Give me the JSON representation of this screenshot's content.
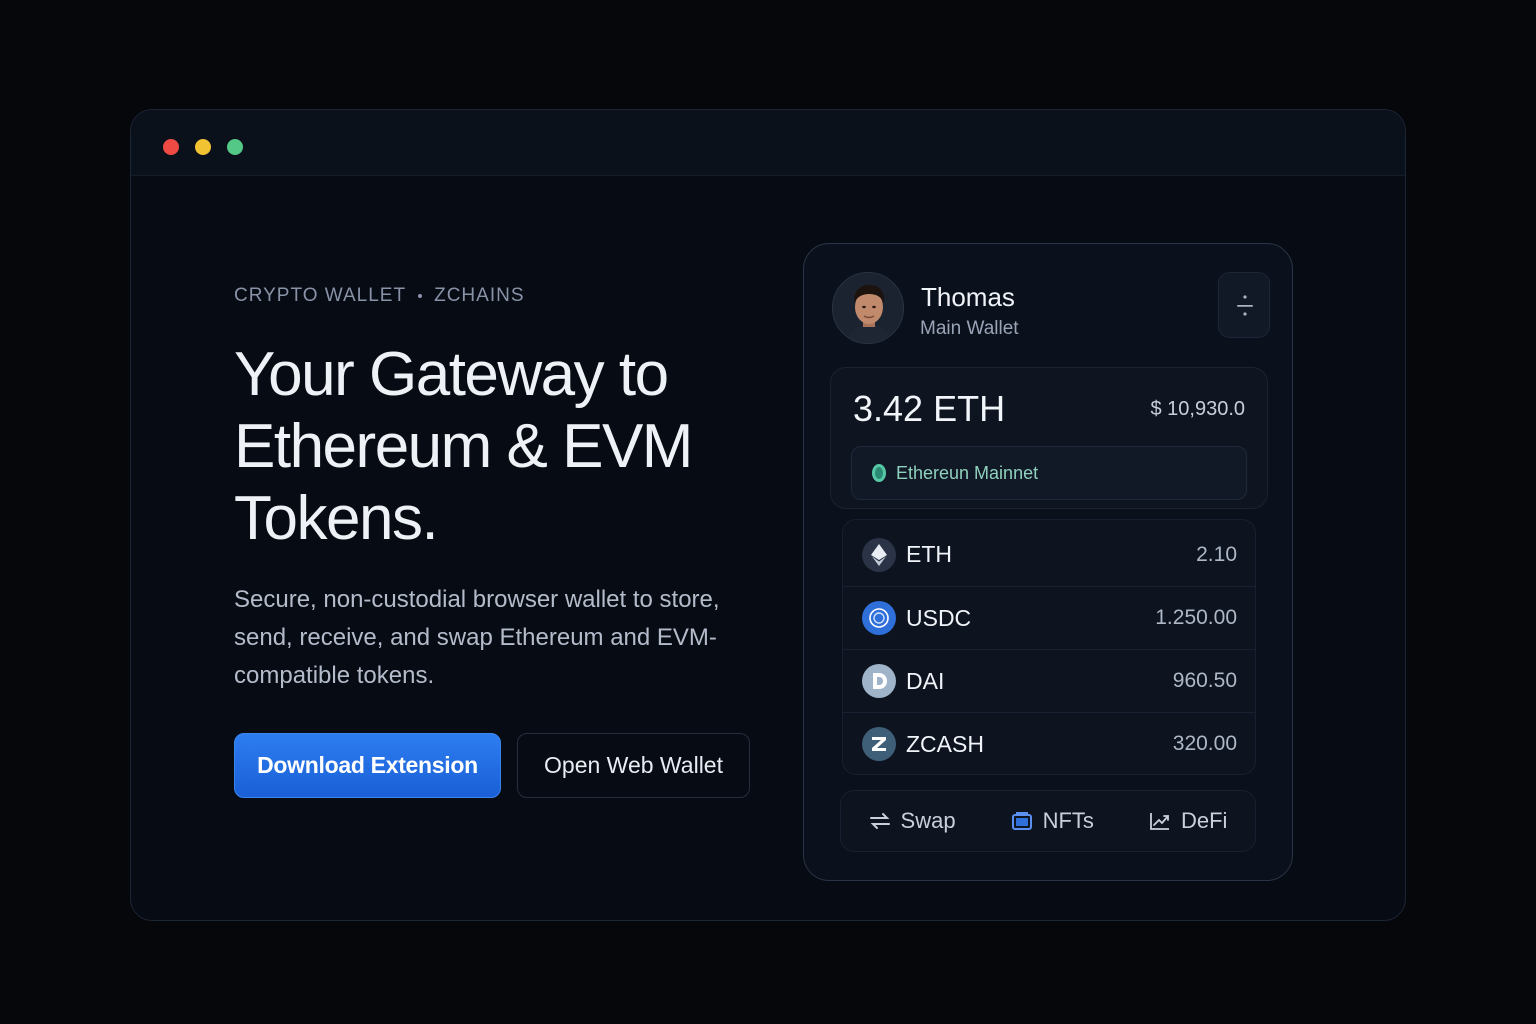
{
  "hero": {
    "eyebrow_left": "CRYPTO WALLET",
    "eyebrow_right": "ZCHAINS",
    "headline": "Your Gateway to Ethereum & EVM Tokens.",
    "subtitle": "Secure, non-custodial browser wallet to store, send, receive, and swap Ethereum and EVM-compatible tokens.",
    "primary_cta": "Download Extension",
    "secondary_cta": "Open Web Wallet"
  },
  "wallet": {
    "user_name": "Thomas",
    "wallet_label": "Main Wallet",
    "eth_balance": "3.42 ETH",
    "usd_balance": "$ 10,930.0",
    "network": "Ethereun Mainnet",
    "tokens": [
      {
        "symbol": "ETH",
        "amount": "2.10",
        "icon": "ethereum-icon",
        "color": "#2a3446"
      },
      {
        "symbol": "USDC",
        "amount": "1.250.00",
        "icon": "usdc-icon",
        "color": "#2f6fd9"
      },
      {
        "symbol": "DAI",
        "amount": "960.50",
        "icon": "dai-icon",
        "color": "#9fb4c9"
      },
      {
        "symbol": "ZCASH",
        "amount": "320.00",
        "icon": "zcash-icon",
        "color": "#3f5f78"
      }
    ],
    "nav": [
      {
        "label": "Swap",
        "icon": "swap-icon"
      },
      {
        "label": "NFTs",
        "icon": "nft-icon"
      },
      {
        "label": "DeFi",
        "icon": "chart-icon"
      }
    ]
  },
  "colors": {
    "accent": "#2b7cf0",
    "background": "#05070b",
    "network_green": "#57c8a6"
  }
}
